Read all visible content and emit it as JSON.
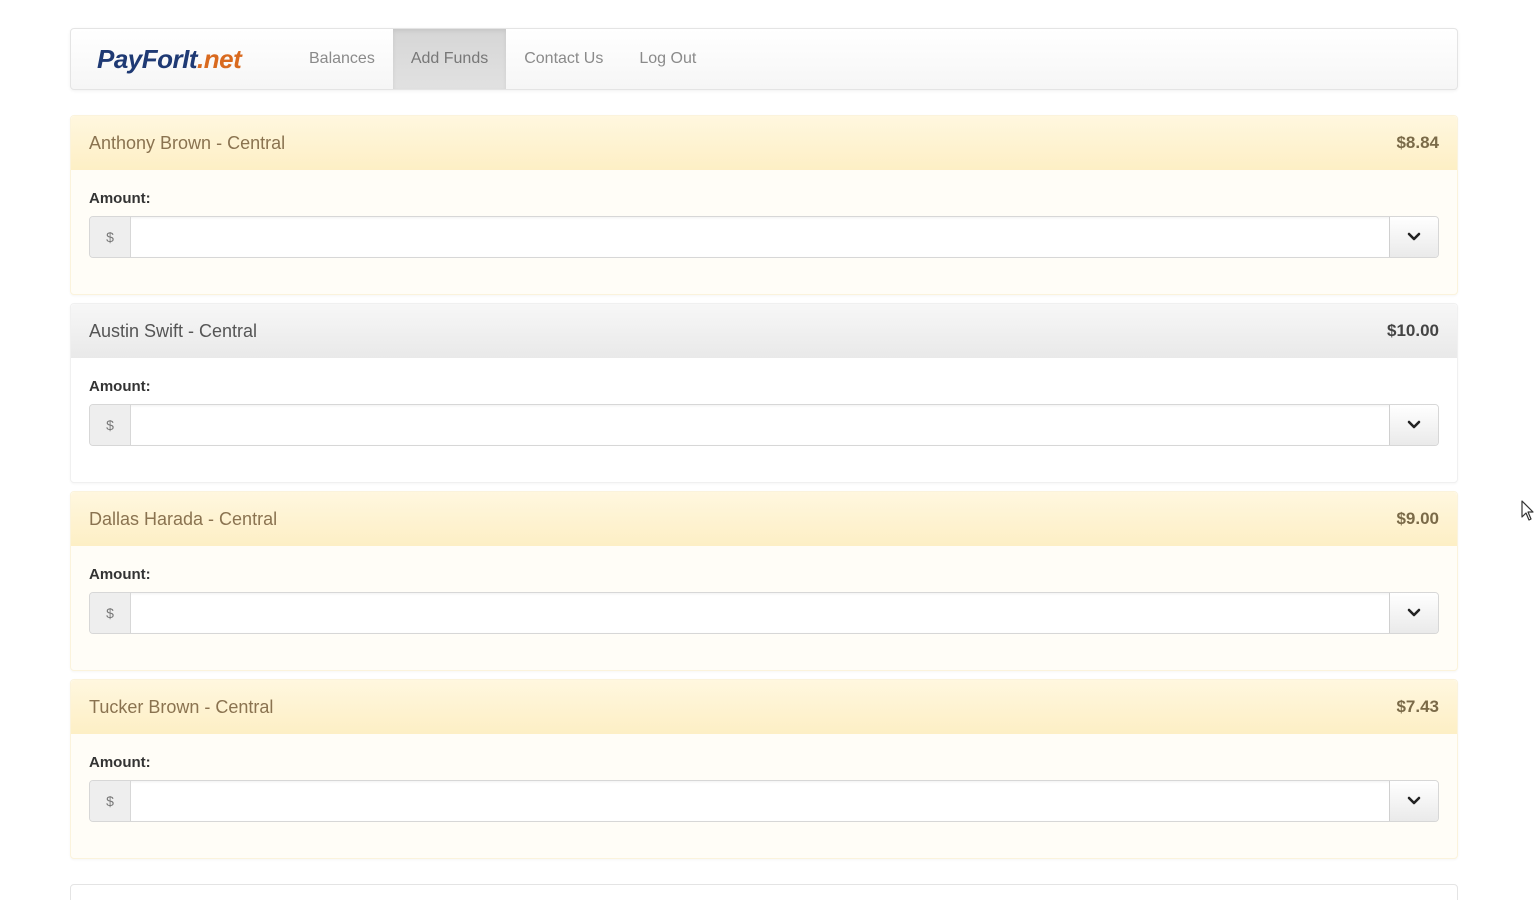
{
  "brand": {
    "part1": "PayForIt",
    "part2": ".net"
  },
  "nav": [
    {
      "label": "Balances",
      "active": false
    },
    {
      "label": "Add Funds",
      "active": true
    },
    {
      "label": "Contact Us",
      "active": false
    },
    {
      "label": "Log Out",
      "active": false
    }
  ],
  "accounts": [
    {
      "name": "Anthony Brown - Central",
      "balance": "$8.84",
      "style": "warning",
      "amount_label": "Amount:",
      "currency": "$",
      "amount_value": ""
    },
    {
      "name": "Austin Swift - Central",
      "balance": "$10.00",
      "style": "default",
      "amount_label": "Amount:",
      "currency": "$",
      "amount_value": ""
    },
    {
      "name": "Dallas Harada - Central",
      "balance": "$9.00",
      "style": "warning",
      "amount_label": "Amount:",
      "currency": "$",
      "amount_value": ""
    },
    {
      "name": "Tucker Brown - Central",
      "balance": "$7.43",
      "style": "warning",
      "amount_label": "Amount:",
      "currency": "$",
      "amount_value": ""
    }
  ],
  "icons": {
    "dropdown": "chevron-down-icon",
    "cursor": "mouse-pointer-icon"
  },
  "colors": {
    "warning_heading": "#fdf1cc",
    "default_heading": "#ececec",
    "brand_primary": "#1f3a74",
    "brand_accent": "#d96a1f"
  }
}
